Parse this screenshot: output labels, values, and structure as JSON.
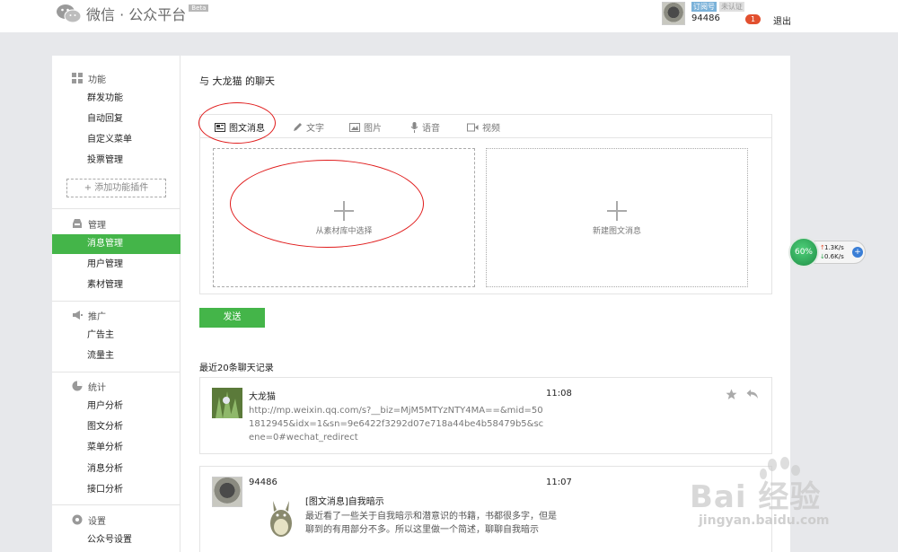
{
  "header": {
    "title": "微信 · 公众平台",
    "beta": "Beta",
    "account_type": "订阅号",
    "verify_status": "未认证",
    "account_id": "94486",
    "notification_count": "1",
    "logout": "退出"
  },
  "sidebar": {
    "sections": [
      {
        "title": "功能",
        "icon": "grid-icon",
        "items": [
          "群发功能",
          "自动回复",
          "自定义菜单",
          "投票管理"
        ]
      },
      {
        "title": "管理",
        "icon": "inbox-icon",
        "items": [
          "消息管理",
          "用户管理",
          "素材管理"
        ]
      },
      {
        "title": "推广",
        "icon": "megaphone-icon",
        "items": [
          "广告主",
          "流量主"
        ]
      },
      {
        "title": "统计",
        "icon": "pie-chart-icon",
        "items": [
          "用户分析",
          "图文分析",
          "菜单分析",
          "消息分析",
          "接口分析"
        ]
      },
      {
        "title": "设置",
        "icon": "gear-icon",
        "items": [
          "公众号设置"
        ]
      }
    ],
    "add_plugin": "+ 添加功能插件",
    "active_item": "消息管理"
  },
  "chat": {
    "title": "与 大龙猫 的聊天",
    "tabs": [
      "图文消息",
      "文字",
      "图片",
      "语音",
      "视频"
    ],
    "active_tab": "图文消息",
    "pick_from_library": "从素材库中选择",
    "new_news": "新建图文消息",
    "send": "发送"
  },
  "history": {
    "title": "最近20条聊天记录",
    "messages": [
      {
        "name": "大龙猫",
        "time": "11:08",
        "body": "http://mp.weixin.qq.com/s?__biz=MjM5MTYzNTY4MA==&mid=501812945&idx=1&sn=9e6422f3292d07e718a44be4b58479b5&scene=0#wechat_redirect"
      },
      {
        "name": "94486",
        "time": "11:07",
        "news_title": "[图文消息]自我暗示",
        "news_desc": "最近看了一些关于自我暗示和潜意识的书籍，书都很多字，但是聊到的有用部分不多。所以这里做一个简述，聊聊自我暗示"
      }
    ]
  },
  "net_widget": {
    "percent": "60%",
    "up": "1.3K/s",
    "down": "0.6K/s"
  },
  "watermark": {
    "logo": "Bai 经验",
    "url": "jingyan.baidu.com"
  }
}
